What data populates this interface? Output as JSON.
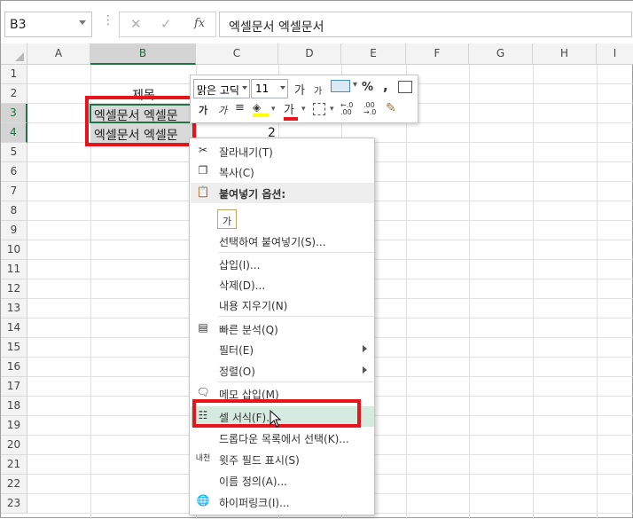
{
  "formula_bar": {
    "name_box": "B3",
    "fx_label": "fx",
    "cancel": "✕",
    "enter": "✓",
    "content": "엑셀문서 엑셀문서"
  },
  "columns": [
    "A",
    "B",
    "C",
    "D",
    "E",
    "F",
    "G",
    "H",
    "I"
  ],
  "rows": [
    "1",
    "2",
    "3",
    "4",
    "5",
    "6",
    "7",
    "8",
    "9",
    "10",
    "11",
    "12",
    "13",
    "14",
    "15",
    "16",
    "17",
    "18",
    "19",
    "20",
    "21",
    "22",
    "23"
  ],
  "cells": {
    "B2": "제목",
    "B3": "엑셀문서 엑셀문",
    "B4": "엑셀문서 엑셀문",
    "C4": "2"
  },
  "mini_toolbar": {
    "font": "맑은 고딕",
    "size": "11",
    "grow": "가",
    "shrink": "가",
    "percent": "%",
    "comma": ",",
    "bold": "가",
    "italic": "가",
    "fontcolor": "가",
    "dec_inc": "←.0 .00",
    "dec_dec": ".00 →.0"
  },
  "context_menu": {
    "items": [
      {
        "label": "잘라내기(T)",
        "icon": "scissors-icon"
      },
      {
        "label": "복사(C)",
        "icon": "copy-icon"
      },
      {
        "label": "붙여넣기 옵션:",
        "icon": "paste-icon"
      },
      {
        "label": "가",
        "icon": "paste-option-icon"
      },
      {
        "label": "선택하여 붙여넣기(S)...",
        "icon": ""
      },
      {
        "label": "삽입(I)...",
        "icon": ""
      },
      {
        "label": "삭제(D)...",
        "icon": ""
      },
      {
        "label": "내용 지우기(N)",
        "icon": ""
      },
      {
        "label": "빠른 분석(Q)",
        "icon": "quick-analysis-icon"
      },
      {
        "label": "필터(E)",
        "icon": ""
      },
      {
        "label": "정렬(O)",
        "icon": ""
      },
      {
        "label": "메모 삽입(M)",
        "icon": "comment-icon"
      },
      {
        "label": "셀 서식(F)...",
        "icon": "format-cells-icon"
      },
      {
        "label": "드롭다운 목록에서 선택(K)...",
        "icon": ""
      },
      {
        "label": "윗주 필드 표시(S)",
        "icon": "phonetic-icon"
      },
      {
        "label": "이름 정의(A)...",
        "icon": ""
      },
      {
        "label": "하이퍼링크(I)...",
        "icon": "hyperlink-icon"
      }
    ]
  },
  "colors": {
    "highlight": "#e8141b",
    "excel_green": "#217346",
    "menu_hover": "#d6ebdf"
  }
}
